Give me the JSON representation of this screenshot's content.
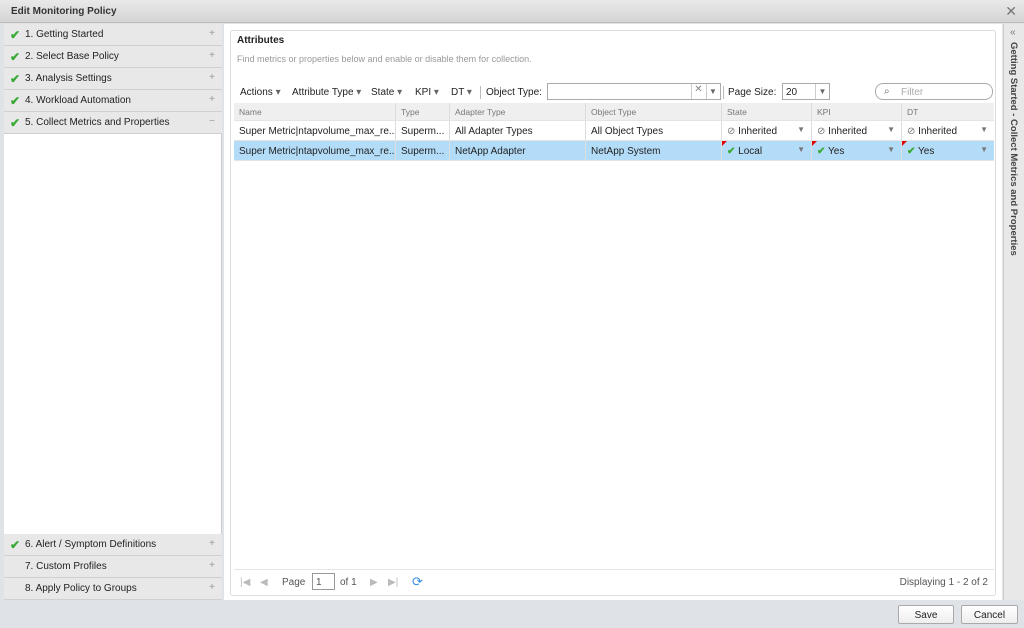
{
  "window": {
    "title": "Edit Monitoring Policy",
    "close_icon": "close-icon"
  },
  "steps": [
    {
      "label": "1. Getting Started",
      "done": true,
      "state": "+"
    },
    {
      "label": "2. Select Base Policy",
      "done": true,
      "state": "+"
    },
    {
      "label": "3. Analysis Settings",
      "done": true,
      "state": "+"
    },
    {
      "label": "4. Workload Automation",
      "done": true,
      "state": "+"
    },
    {
      "label": "5. Collect Metrics and Properties",
      "done": true,
      "state": "−"
    },
    {
      "label": "6. Alert / Symptom Definitions",
      "done": true,
      "state": "+"
    },
    {
      "label": "7. Custom Profiles",
      "done": false,
      "state": "+"
    },
    {
      "label": "8. Apply Policy to Groups",
      "done": false,
      "state": "+"
    }
  ],
  "attributes": {
    "title": "Attributes",
    "description": "Find metrics or properties below and enable or disable them for collection.",
    "toolbar": {
      "actions": "Actions",
      "attribute_type": "Attribute Type",
      "state": "State",
      "kpi": "KPI",
      "dt": "DT",
      "object_type_label": "Object Type:",
      "object_type_value": "",
      "page_size_label": "Page Size:",
      "page_size": "20",
      "filter_placeholder": "Filter"
    },
    "columns": [
      "Name",
      "Type",
      "Adapter Type",
      "Object Type",
      "State",
      "KPI",
      "DT"
    ],
    "rows": [
      {
        "name": "Super Metric|ntapvolume_max_re...",
        "type": "Superm...",
        "adapter": "All Adapter Types",
        "object": "All Object Types",
        "state": "Inherited",
        "kpi": "Inherited",
        "dt": "Inherited",
        "selected": false
      },
      {
        "name": "Super Metric|ntapvolume_max_re...",
        "type": "Superm...",
        "adapter": "NetApp Adapter",
        "object": "NetApp System",
        "state": "Local",
        "kpi": "Yes",
        "dt": "Yes",
        "selected": true
      }
    ],
    "pager": {
      "page_label": "Page",
      "page": "1",
      "of": "of 1",
      "displaying": "Displaying 1 - 2 of 2"
    }
  },
  "side_panel": {
    "label": "Getting Started - Collect Metrics and Properties",
    "collapse": "«"
  },
  "footer": {
    "save": "Save",
    "cancel": "Cancel"
  },
  "colors": {
    "check": "#3aa935",
    "selected_row": "#b3dcf8"
  }
}
